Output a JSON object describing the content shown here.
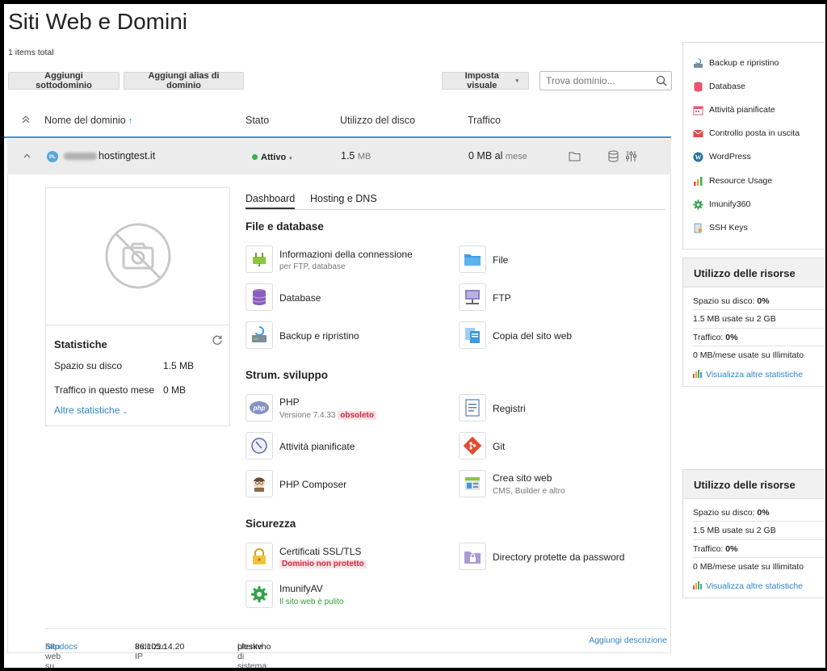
{
  "header": {
    "title": "Siti Web e Domini",
    "items_total": "1 items total"
  },
  "toolbar": {
    "add_subdomain": "Aggiungi sottodominio",
    "add_alias": "Aggiungi alias di dominio",
    "view_settings": "Imposta visuale",
    "search_placeholder": "Trova dominio..."
  },
  "table": {
    "col_domain": "Nome del dominio",
    "col_status": "Stato",
    "col_disk": "Utilizzo del disco",
    "col_traffic": "Traffico"
  },
  "domain_row": {
    "favicon_text": "PL",
    "domain_suffix": "hostingtest.it",
    "status": "Attivo",
    "disk_value": "1.5",
    "disk_unit": "MB",
    "traffic_value": "0 MB al",
    "traffic_unit": "mese"
  },
  "stats": {
    "title": "Statistiche",
    "disk_label": "Spazio su disco",
    "disk_value": "1.5 MB",
    "traffic_label": "Traffico in questo mese",
    "traffic_value": "0 MB",
    "more": "Altre statistiche"
  },
  "tabs": {
    "dashboard": "Dashboard",
    "hosting_dns": "Hosting e DNS"
  },
  "sections": {
    "files_db": "File e database",
    "dev_tools": "Strum. sviluppo",
    "security": "Sicurezza"
  },
  "tools": {
    "connection_info": {
      "name": "Informazioni della connessione",
      "sub": "per FTP, database"
    },
    "files": {
      "name": "File"
    },
    "database": {
      "name": "Database"
    },
    "ftp": {
      "name": "FTP"
    },
    "backup": {
      "name": "Backup e ripristino"
    },
    "copy_site": {
      "name": "Copia del sito web"
    },
    "php": {
      "name": "PHP",
      "sub": "Versione 7.4.33",
      "badge": "obsoleto"
    },
    "logs": {
      "name": "Registri"
    },
    "scheduled": {
      "name": "Attività pianificate"
    },
    "git": {
      "name": "Git"
    },
    "composer": {
      "name": "PHP Composer"
    },
    "site_builder": {
      "name": "Crea sito web",
      "sub": "CMS, Builder e altro"
    },
    "ssl": {
      "name": "Certificati SSL/TLS",
      "badge": "Dominio non protetto"
    },
    "protected_dirs": {
      "name": "Directory protette da password"
    },
    "imunifyav": {
      "name": "ImunifyAV",
      "sub": "Il sito web è pulito"
    }
  },
  "footer": {
    "site_on": "Sito web su",
    "site_on_link": "httpdocs",
    "ip_label": "Indirizzo IP",
    "ip_value": "86.105.14.20",
    "user_label": "Utente di sistema",
    "user_value": "pleskvho",
    "add_description": "Aggiungi descrizione"
  },
  "sidebar": {
    "items": [
      {
        "label": "Backup e ripristino",
        "icon": "backup-icon"
      },
      {
        "label": "Database",
        "icon": "database-icon"
      },
      {
        "label": "Attività pianificate",
        "icon": "calendar-icon"
      },
      {
        "label": "Controllo posta in uscita",
        "icon": "mail-icon"
      },
      {
        "label": "WordPress",
        "icon": "wordpress-icon"
      },
      {
        "label": "Resource Usage",
        "icon": "bar-chart-icon"
      },
      {
        "label": "Imunify360",
        "icon": "gear-shield-icon"
      },
      {
        "label": "SSH Keys",
        "icon": "key-file-icon"
      }
    ],
    "resources": [
      {
        "title": "Utilizzo delle risorse",
        "disk_label": "Spazio su disco:",
        "disk_pct": "0%",
        "disk_detail": "1.5 MB usate su 2 GB",
        "traffic_label": "Traffico:",
        "traffic_pct": "0%",
        "traffic_detail": "0 MB/mese usate su Illimitato",
        "more": "Visualizza altre statistiche"
      },
      {
        "title": "Utilizzo delle risorse",
        "disk_label": "Spazio su disco:",
        "disk_pct": "0%",
        "disk_detail": "1.5 MB usate su 2 GB",
        "traffic_label": "Traffico:",
        "traffic_pct": "0%",
        "traffic_detail": "0 MB/mese usate su Illimitato",
        "more": "Visualizza altre statistiche"
      }
    ]
  },
  "colors": {
    "accent": "#2f86c9",
    "active_green": "#3ab14a",
    "danger": "#c9283a"
  }
}
